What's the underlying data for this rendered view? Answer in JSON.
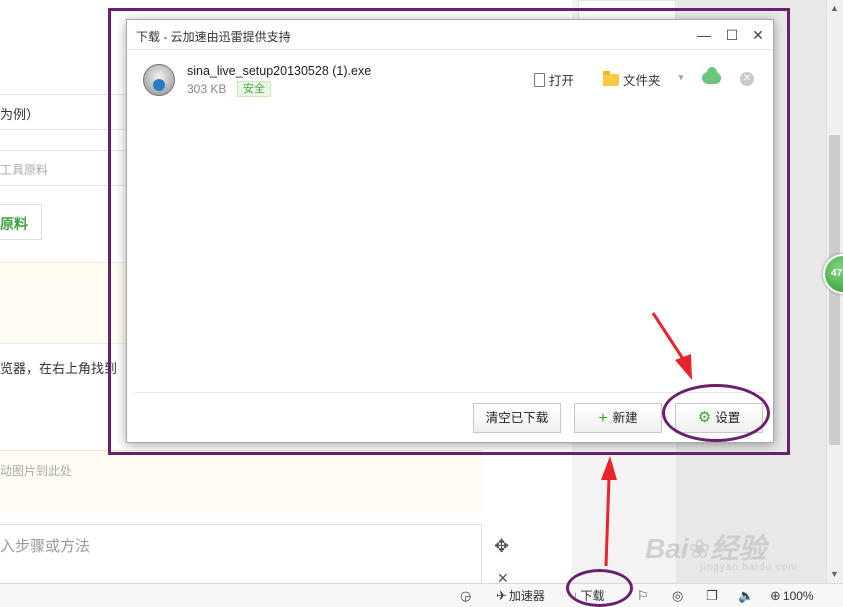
{
  "background_page": {
    "row1_text": "为例）",
    "row2_placeholder": "工具原料",
    "green_button_label": "原料",
    "paragraph_text": "览器，在右上角找到",
    "yellow2_placeholder": "动图片到此处",
    "textarea_placeholder": "入步骤或方法",
    "badge_number": "47"
  },
  "dialog": {
    "title": "下载 - 云加速由迅雷提供支持",
    "file": {
      "name": "sina_live_setup20130528 (1).exe",
      "size": "303 KB",
      "status": "安全"
    },
    "actions": {
      "open": "打开",
      "folder": "文件夹"
    },
    "buttons": {
      "clear": "清空已下载",
      "new": "新建",
      "settings": "设置"
    }
  },
  "statusbar": {
    "accelerator": "加速器",
    "download": "下载",
    "zoom": "100%"
  },
  "watermark": {
    "text": "Bai",
    "text2": "经验",
    "sub": "jingyan.baidu.com"
  },
  "colors": {
    "annotation": "#6c1f6c",
    "arrow": "#e8242a",
    "accent_green": "#3da33d"
  }
}
